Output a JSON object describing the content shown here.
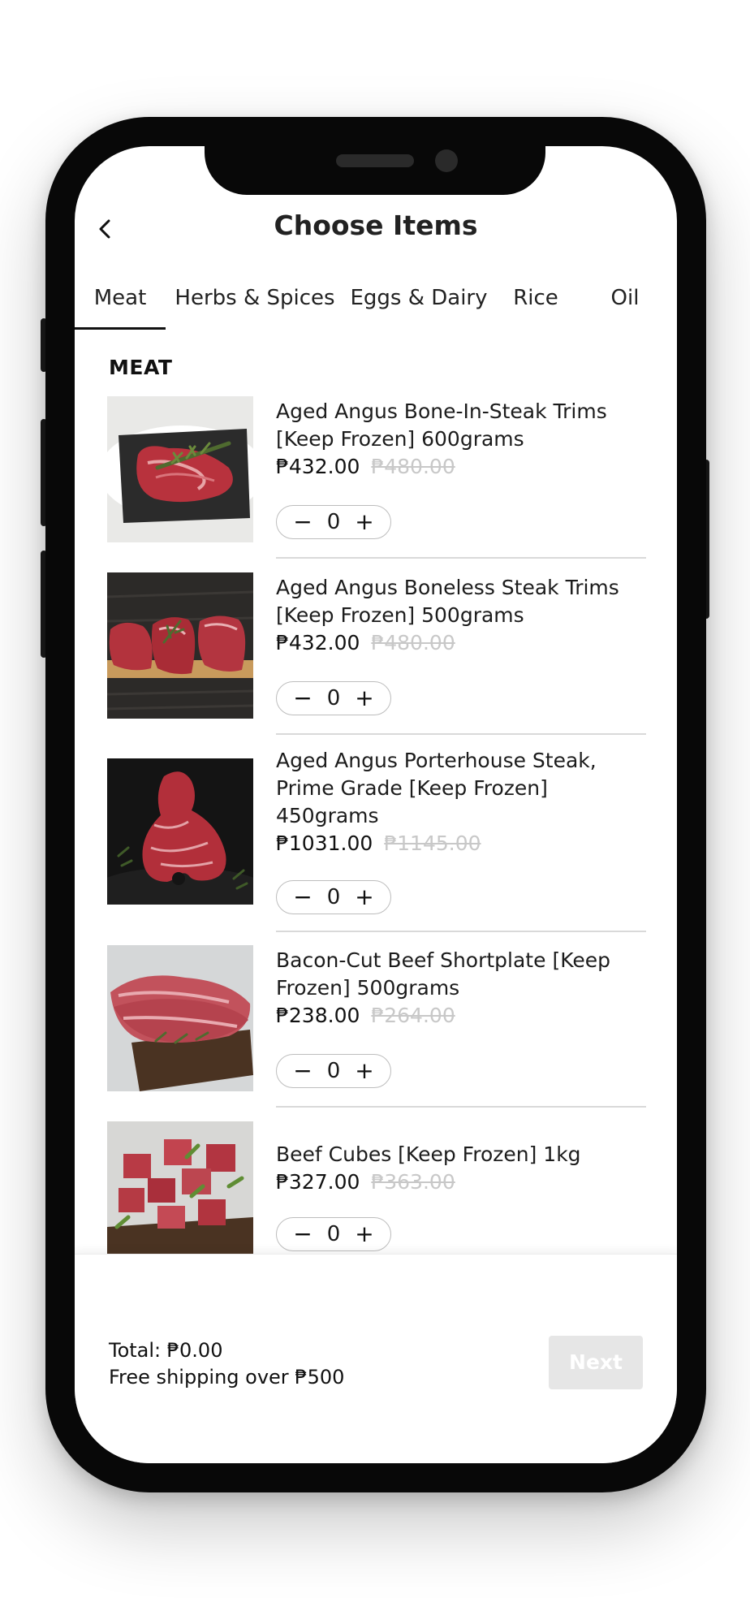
{
  "header": {
    "title": "Choose Items",
    "back_icon": "chevron-left-icon"
  },
  "tabs": [
    {
      "label": "Meat",
      "active": true
    },
    {
      "label": "Herbs & Spices",
      "active": false
    },
    {
      "label": "Eggs & Dairy",
      "active": false
    },
    {
      "label": "Rice",
      "active": false
    },
    {
      "label": "Oil",
      "active": false
    }
  ],
  "section": {
    "title": "MEAT"
  },
  "products": [
    {
      "name": "Aged Angus Bone-In-Steak Trims [Keep Frozen]  600grams",
      "price": "₱432.00",
      "old_price": "₱480.00",
      "qty": "0"
    },
    {
      "name": "Aged Angus Boneless Steak Trims [Keep Frozen]  500grams",
      "price": "₱432.00",
      "old_price": "₱480.00",
      "qty": "0"
    },
    {
      "name": "Aged Angus Porterhouse Steak, Prime Grade [Keep Frozen]  450grams",
      "price": "₱1031.00",
      "old_price": "₱1145.00",
      "qty": "0"
    },
    {
      "name": "Bacon-Cut Beef Shortplate [Keep Frozen]  500grams",
      "price": "₱238.00",
      "old_price": "₱264.00",
      "qty": "0"
    },
    {
      "name": "Beef Cubes [Keep Frozen]  1kg",
      "price": "₱327.00",
      "old_price": "₱363.00",
      "qty": "0"
    }
  ],
  "stepper": {
    "minus": "−",
    "plus": "+"
  },
  "footer": {
    "total": "Total: ₱0.00",
    "shipping": "Free shipping over ₱500",
    "next_label": "Next"
  },
  "colors": {
    "accent": "#111111",
    "disabled_button": "#e6e6e6",
    "strike_price": "#c8c8c8",
    "divider": "#d9d9d9"
  }
}
